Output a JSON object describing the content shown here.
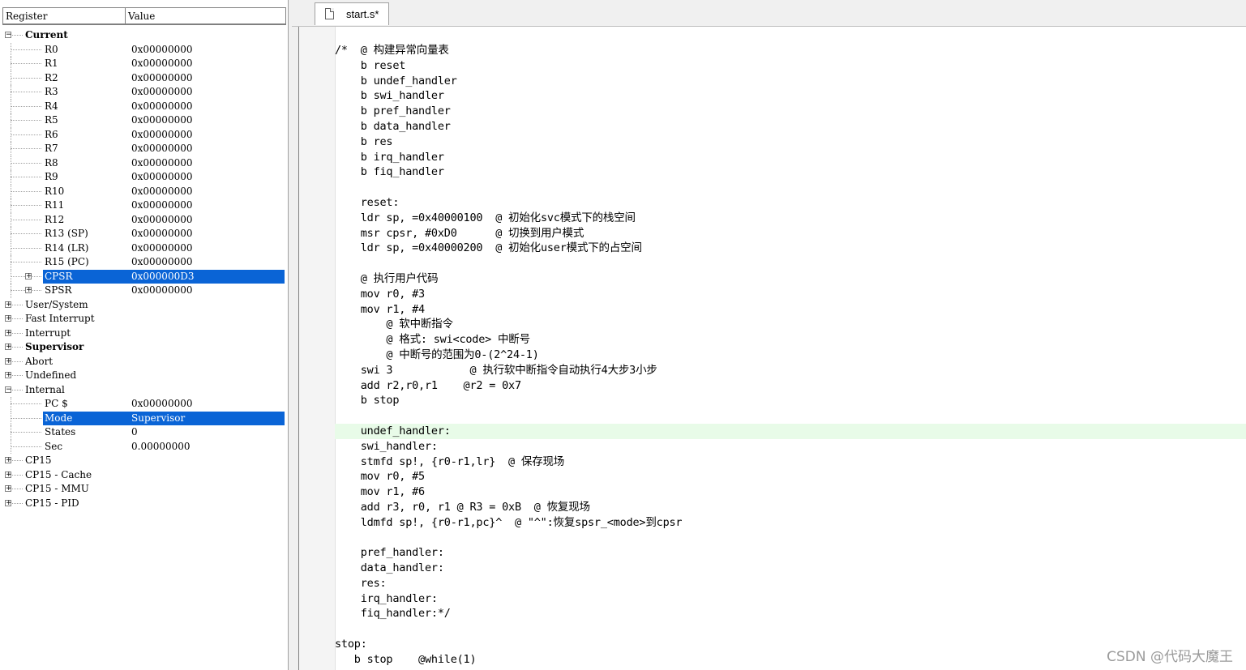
{
  "registers": {
    "header": {
      "register": "Register",
      "value": "Value"
    },
    "rows": [
      {
        "level": 0,
        "expander": "minus",
        "name": "Current",
        "value": "",
        "bold": true
      },
      {
        "level": 1,
        "expander": "",
        "name": "R0",
        "value": "0x00000000"
      },
      {
        "level": 1,
        "expander": "",
        "name": "R1",
        "value": "0x00000000"
      },
      {
        "level": 1,
        "expander": "",
        "name": "R2",
        "value": "0x00000000"
      },
      {
        "level": 1,
        "expander": "",
        "name": "R3",
        "value": "0x00000000"
      },
      {
        "level": 1,
        "expander": "",
        "name": "R4",
        "value": "0x00000000"
      },
      {
        "level": 1,
        "expander": "",
        "name": "R5",
        "value": "0x00000000"
      },
      {
        "level": 1,
        "expander": "",
        "name": "R6",
        "value": "0x00000000"
      },
      {
        "level": 1,
        "expander": "",
        "name": "R7",
        "value": "0x00000000"
      },
      {
        "level": 1,
        "expander": "",
        "name": "R8",
        "value": "0x00000000"
      },
      {
        "level": 1,
        "expander": "",
        "name": "R9",
        "value": "0x00000000"
      },
      {
        "level": 1,
        "expander": "",
        "name": "R10",
        "value": "0x00000000"
      },
      {
        "level": 1,
        "expander": "",
        "name": "R11",
        "value": "0x00000000"
      },
      {
        "level": 1,
        "expander": "",
        "name": "R12",
        "value": "0x00000000"
      },
      {
        "level": 1,
        "expander": "",
        "name": "R13 (SP)",
        "value": "0x00000000"
      },
      {
        "level": 1,
        "expander": "",
        "name": "R14 (LR)",
        "value": "0x00000000"
      },
      {
        "level": 1,
        "expander": "",
        "name": "R15 (PC)",
        "value": "0x00000000"
      },
      {
        "level": 1,
        "expander": "plus",
        "name": "CPSR",
        "value": "0x000000D3",
        "selected": true
      },
      {
        "level": 1,
        "expander": "plus",
        "name": "SPSR",
        "value": "0x00000000"
      },
      {
        "level": 0,
        "expander": "plus",
        "name": "User/System",
        "value": ""
      },
      {
        "level": 0,
        "expander": "plus",
        "name": "Fast Interrupt",
        "value": ""
      },
      {
        "level": 0,
        "expander": "plus",
        "name": "Interrupt",
        "value": ""
      },
      {
        "level": 0,
        "expander": "plus",
        "name": "Supervisor",
        "value": "",
        "bold": true
      },
      {
        "level": 0,
        "expander": "plus",
        "name": "Abort",
        "value": ""
      },
      {
        "level": 0,
        "expander": "plus",
        "name": "Undefined",
        "value": ""
      },
      {
        "level": 0,
        "expander": "minus",
        "name": "Internal",
        "value": ""
      },
      {
        "level": 1,
        "expander": "",
        "name": "PC  $",
        "value": "0x00000000"
      },
      {
        "level": 1,
        "expander": "",
        "name": "Mode",
        "value": "Supervisor",
        "selected": true
      },
      {
        "level": 1,
        "expander": "",
        "name": "States",
        "value": "0"
      },
      {
        "level": 1,
        "expander": "",
        "name": "Sec",
        "value": "0.00000000"
      },
      {
        "level": 0,
        "expander": "plus",
        "name": "CP15",
        "value": ""
      },
      {
        "level": 0,
        "expander": "plus",
        "name": "CP15 - Cache",
        "value": ""
      },
      {
        "level": 0,
        "expander": "plus",
        "name": "CP15 - MMU",
        "value": ""
      },
      {
        "level": 0,
        "expander": "plus",
        "name": "CP15 - PID",
        "value": ""
      }
    ]
  },
  "editor": {
    "tab_label": "start.s*",
    "highlight_line": 25,
    "lines": [
      "/*  @ 构建异常向量表",
      "    b reset",
      "    b undef_handler",
      "    b swi_handler",
      "    b pref_handler",
      "    b data_handler",
      "    b res",
      "    b irq_handler",
      "    b fiq_handler",
      "",
      "    reset:",
      "    ldr sp, =0x40000100  @ 初始化svc模式下的栈空间",
      "    msr cpsr, #0xD0      @ 切换到用户模式",
      "    ldr sp, =0x40000200  @ 初始化user模式下的占空间",
      "",
      "    @ 执行用户代码",
      "    mov r0, #3",
      "    mov r1, #4",
      "        @ 软中断指令",
      "        @ 格式: swi<code> 中断号",
      "        @ 中断号的范围为0-(2^24-1)",
      "    swi 3            @ 执行软中断指令自动执行4大步3小步",
      "    add r2,r0,r1    @r2 = 0x7",
      "    b stop",
      "",
      "    undef_handler:",
      "    swi_handler:",
      "    stmfd sp!, {r0-r1,lr}  @ 保存现场",
      "    mov r0, #5",
      "    mov r1, #6",
      "    add r3, r0, r1 @ R3 = 0xB  @ 恢复现场",
      "    ldmfd sp!, {r0-r1,pc}^  @ \"^\":恢复spsr_<mode>到cpsr",
      "",
      "    pref_handler:",
      "    data_handler:",
      "    res:",
      "    irq_handler:",
      "    fiq_handler:*/",
      "",
      "stop:",
      "   b stop    @while(1)"
    ]
  },
  "watermark": "CSDN @代码大魔王",
  "colors": {
    "selection": "#0a64d6",
    "line_highlight": "#e8fbe8"
  }
}
